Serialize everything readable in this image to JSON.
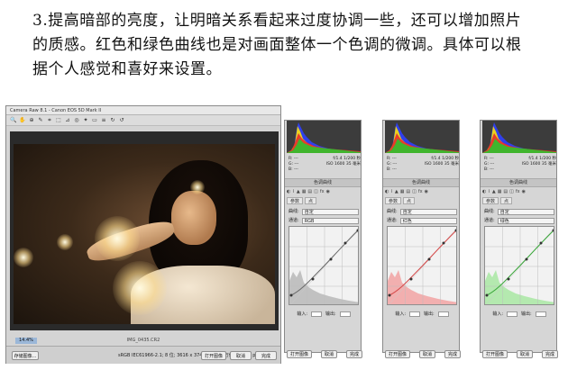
{
  "intro": {
    "lines": [
      "3.提高暗部的亮度，让明暗关系看起来过度协调一些，还可以增加照片",
      "的质感。红色和绿色曲线也是对画面整体一个色调的微调。具体可以根",
      "据个人感觉和喜好来设置。"
    ]
  },
  "main_window": {
    "title": "Camera Raw 8.1  -  Canon EOS 5D Mark II",
    "tools": [
      "🔍",
      "✋",
      "⊕",
      "✎",
      "⌗",
      "⬚",
      "⊿",
      "◎",
      "✦",
      "▭",
      "≡",
      "↻",
      "↺"
    ],
    "filename": "IMG_0435.CR2",
    "zoom": "14.4%",
    "buttons": {
      "save": "存储图像...",
      "open": "打开图像",
      "cancel": "取消",
      "done": "完成"
    },
    "info": "sRGB IEC61966-2.1; 8 位; 3616 x 3746 (13.5 百万像素); 300 ppi"
  },
  "panels": [
    {
      "color": "#6a6a6a",
      "fill": "#b9b9b9",
      "readout": {
        "r": "R: ---",
        "g": "G: ---",
        "b": "B: ---",
        "f": "f/1.4  1/200 秒",
        "iso": "ISO 1600  35 毫米"
      },
      "tabs": "色调曲线",
      "subtab_a": "参数",
      "subtab_b": "点",
      "curve_label": "曲线:",
      "curve_value": "自定",
      "channel_label": "通道:",
      "channel_value": "RGB",
      "input_label": "输入:",
      "output_label": "输出:",
      "buttons": {
        "open": "打开图像",
        "cancel": "取消",
        "done": "完成"
      }
    },
    {
      "color": "#d44848",
      "fill": "#f2a3a3",
      "readout": {
        "r": "R: ---",
        "g": "G: ---",
        "b": "B: ---",
        "f": "f/1.4  1/200 秒",
        "iso": "ISO 1600  35 毫米"
      },
      "tabs": "色调曲线",
      "subtab_a": "参数",
      "subtab_b": "点",
      "curve_label": "曲线:",
      "curve_value": "自定",
      "channel_label": "通道:",
      "channel_value": "红色",
      "input_label": "输入:",
      "output_label": "输出:",
      "buttons": {
        "open": "打开图像",
        "cancel": "取消",
        "done": "完成"
      }
    },
    {
      "color": "#3aa73a",
      "fill": "#a9e7a3",
      "readout": {
        "r": "R: ---",
        "g": "G: ---",
        "b": "B: ---",
        "f": "f/1.4  1/200 秒",
        "iso": "ISO 1600  35 毫米"
      },
      "tabs": "色调曲线",
      "subtab_a": "参数",
      "subtab_b": "点",
      "curve_label": "曲线:",
      "curve_value": "自定",
      "channel_label": "通道:",
      "channel_value": "绿色",
      "input_label": "输入:",
      "output_label": "输出:",
      "buttons": {
        "open": "打开图像",
        "cancel": "取消",
        "done": "完成"
      }
    }
  ]
}
